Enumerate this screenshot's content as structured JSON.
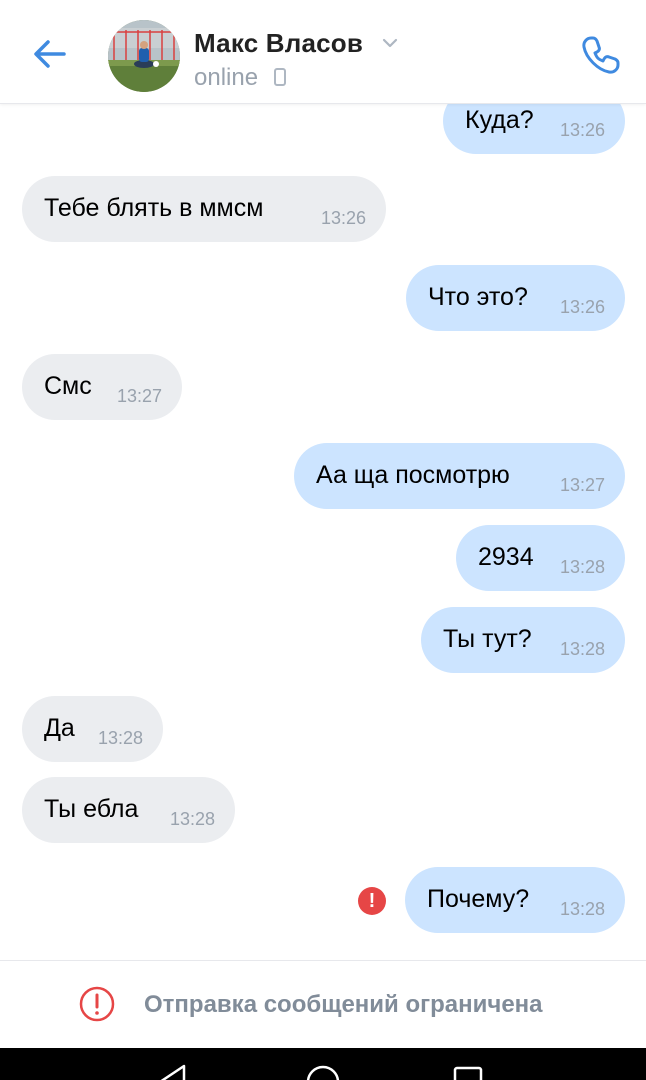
{
  "header": {
    "name": "Макс Власов",
    "status": "online",
    "icons": [
      "back-arrow-icon",
      "chevron-down-icon",
      "phone-device-icon",
      "call-icon"
    ],
    "accent_color": "#3f8ae0"
  },
  "messages": [
    {
      "direction": "out",
      "text": "Куда?",
      "time": "13:26"
    },
    {
      "direction": "in",
      "text": "Тебе блять в ммсм",
      "time": "13:26"
    },
    {
      "direction": "out",
      "text": "Что это?",
      "time": "13:26"
    },
    {
      "direction": "in",
      "text": "Смс",
      "time": "13:27"
    },
    {
      "direction": "out",
      "text": "Аа ща посмотрю",
      "time": "13:27"
    },
    {
      "direction": "out",
      "text": "2934",
      "time": "13:28"
    },
    {
      "direction": "out",
      "text": "Ты тут?",
      "time": "13:28"
    },
    {
      "direction": "in",
      "text": "Да",
      "time": "13:28"
    },
    {
      "direction": "in",
      "text": "Ты ебла",
      "time": "13:28"
    },
    {
      "direction": "out",
      "text": "Почему?",
      "time": "13:28",
      "failed": true
    }
  ],
  "footer": {
    "notice": "Отправка сообщений ограничена",
    "icon": "warning-circle-icon"
  },
  "colors": {
    "incoming_bubble": "#ebedf0",
    "outgoing_bubble": "#cce4ff",
    "error": "#e64646"
  }
}
